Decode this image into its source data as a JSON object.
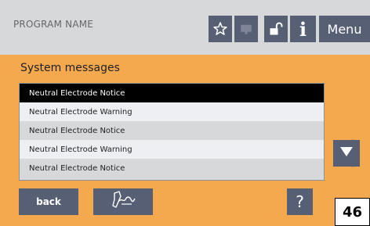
{
  "header": {
    "program_name": "PROGRAM NAME",
    "menu_label": "Menu",
    "info_label": "i"
  },
  "section": {
    "title": "System messages"
  },
  "messages": [
    "Neutral Electrode Notice",
    "Neutral Electrode Warning",
    "Neutral Electrode Notice",
    "Neutral Electrode Warning",
    "Neutral Electrode Notice"
  ],
  "selected_message_index": 0,
  "footer": {
    "back_label": "back",
    "help_label": "?"
  },
  "page_number": "46",
  "icons": {
    "favorite": "star-icon",
    "hand": "hand-icon",
    "lock": "unlock-icon",
    "scroll_down": "triangle-down-icon",
    "signature": "signature-icon"
  },
  "colors": {
    "background": "#f4a94f",
    "header": "#d7d8da",
    "button": "#565f74",
    "selected_row": "#000000",
    "row_light": "#edeff3",
    "row_dark": "#d7d8da"
  }
}
